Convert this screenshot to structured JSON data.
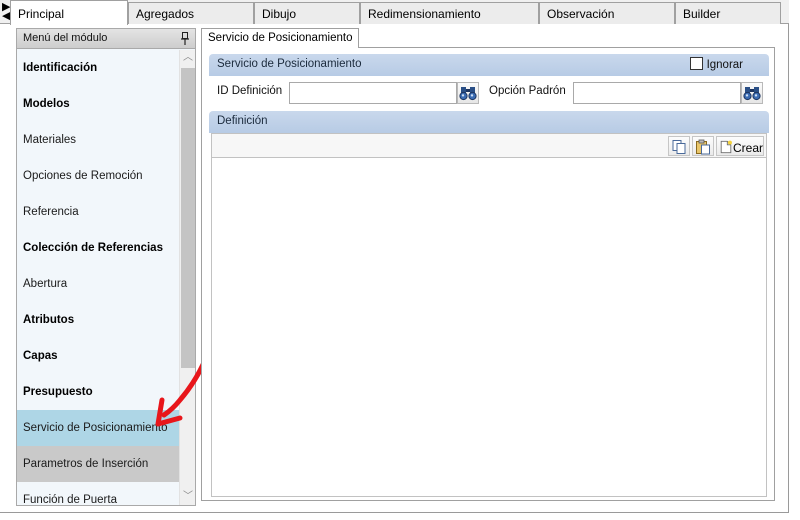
{
  "tabs": [
    {
      "label": "Principal",
      "active": true
    },
    {
      "label": "Agregados",
      "active": false
    },
    {
      "label": "Dibujo",
      "active": false
    },
    {
      "label": "Redimensionamiento",
      "active": false
    },
    {
      "label": "Observación",
      "active": false
    },
    {
      "label": "Builder",
      "active": false
    }
  ],
  "menu": {
    "header": "Menú del módulo",
    "items": [
      {
        "label": "Identificación",
        "bold": true
      },
      {
        "label": "Modelos",
        "bold": true
      },
      {
        "label": "Materiales",
        "bold": false
      },
      {
        "label": "Opciones de Remoción",
        "bold": false
      },
      {
        "label": "Referencia",
        "bold": false
      },
      {
        "label": "Colección de Referencias",
        "bold": true
      },
      {
        "label": "Abertura",
        "bold": false
      },
      {
        "label": "Atributos",
        "bold": true
      },
      {
        "label": "Capas",
        "bold": true
      },
      {
        "label": "Presupuesto",
        "bold": true
      },
      {
        "label": "Servicio de Posicionamiento",
        "bold": false,
        "state": "selected"
      },
      {
        "label": "Parametros de Inserción",
        "bold": false,
        "state": "hover"
      },
      {
        "label": "Función de Puerta",
        "bold": false
      }
    ]
  },
  "panel": {
    "tab_label": "Servicio de Posicionamiento",
    "group_title": "Servicio de Posicionamiento",
    "ignore_label": "Ignorar",
    "ignore_checked": false,
    "id_label": "ID Definición",
    "id_value": "",
    "pattern_label": "Opción Padrón",
    "pattern_value": "",
    "definition_title": "Definición",
    "create_label": "Crear"
  },
  "colors": {
    "selected_item": "#aed6e6",
    "hover_item": "#c9c9c9",
    "group_bar": "#c9d8ec",
    "annotation_arrow": "#e8161b"
  }
}
